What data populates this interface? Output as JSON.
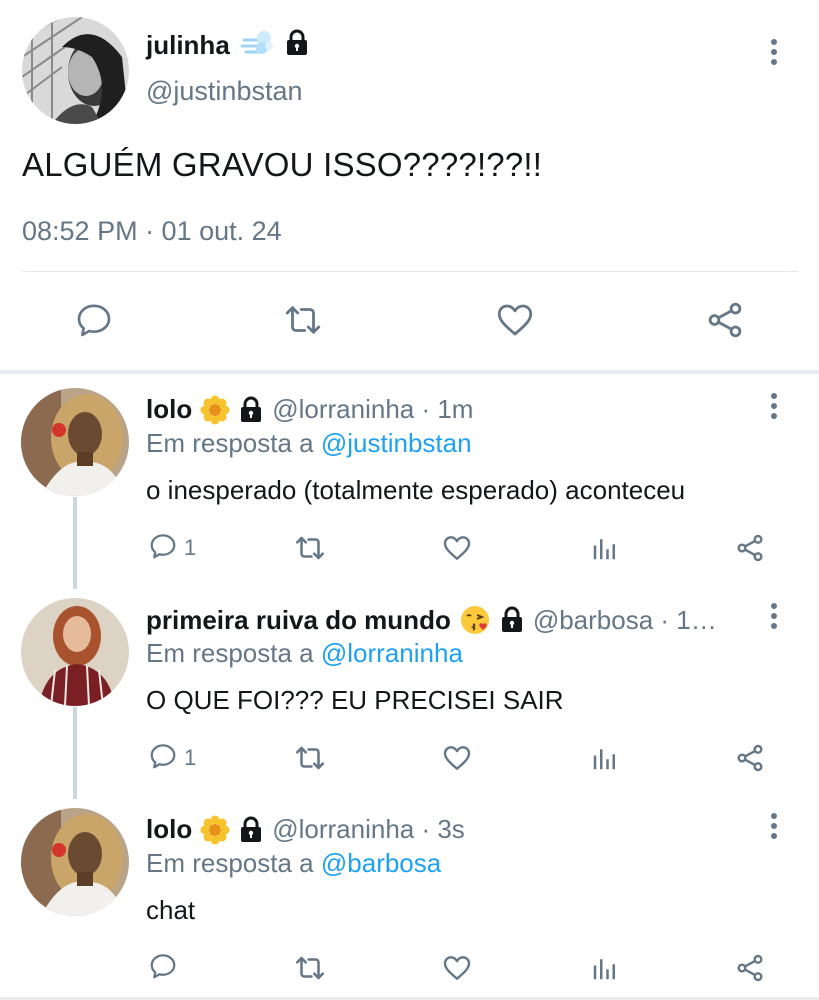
{
  "main_tweet": {
    "name": "julinha",
    "handle": "@justinbstan",
    "text": "ALGUÉM GRAVOU ISSO????!??!!",
    "time": "08:52 PM · 01 out. 24",
    "badges": [
      "dash-emoji-icon",
      "lock-icon"
    ],
    "actions": [
      "reply-icon",
      "retweet-icon",
      "like-icon",
      "share-icon"
    ]
  },
  "replies": [
    {
      "name": "lolo",
      "badges": [
        "sunflower-emoji-icon",
        "lock-icon"
      ],
      "handle": "@lorraninha · 1m",
      "reply_to_prefix": "Em resposta a",
      "reply_to": "@justinbstan",
      "text": "o inesperado (totalmente esperado) aconteceu",
      "reply_count": "1"
    },
    {
      "name": "primeira ruiva do mundo",
      "badges": [
        "kiss-face-emoji-icon",
        "lock-icon"
      ],
      "handle": "@barbosa · 1…",
      "reply_to_prefix": "Em resposta a",
      "reply_to": "@lorraninha",
      "text": "O QUE FOI??? EU PRECISEI SAIR",
      "reply_count": "1"
    },
    {
      "name": "lolo",
      "badges": [
        "sunflower-emoji-icon",
        "lock-icon"
      ],
      "handle": "@lorraninha · 3s",
      "reply_to_prefix": "Em resposta a",
      "reply_to": "@barbosa",
      "text": "chat",
      "reply_count": ""
    }
  ],
  "colors": {
    "text": "#14171a",
    "secondary": "#657786",
    "link": "#1da1f2",
    "divider": "#e1e8ed",
    "thread_line": "#ccd6dd"
  }
}
